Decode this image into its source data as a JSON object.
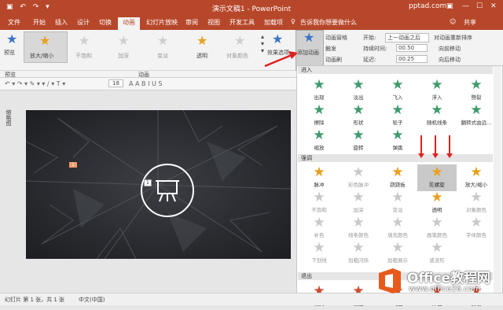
{
  "window": {
    "title": "演示文稿1 - PowerPoint",
    "site": "pptad.com",
    "share": "共享"
  },
  "tabs": [
    "文件",
    "开始",
    "插入",
    "设计",
    "切换",
    "动画",
    "幻灯片放映",
    "审阅",
    "视图",
    "开发工具",
    "加载项"
  ],
  "active_tab_index": 5,
  "tell_me": "告诉我你想要做什么",
  "ribbon": {
    "preview": "预览",
    "effects": [
      "放大/缩小",
      "不饱和",
      "加深",
      "变淡",
      "透明",
      "对象颜色"
    ],
    "effect_options": "效果选项",
    "add_animation": "添加动画",
    "animation_pane": "动画窗格",
    "trigger": "触发",
    "animation_painter": "动画刷",
    "start_label": "开始:",
    "start_value": "上一动画之后",
    "duration_label": "持续时间:",
    "duration_value": "00.50",
    "delay_label": "延迟:",
    "delay_value": "00.25",
    "reorder": "对动画重新排序",
    "move_earlier": "向前移动",
    "move_later": "向后移动",
    "group_preview": "预览",
    "group_animation": "动画",
    "font_size": "18"
  },
  "side_panel": "缩略图",
  "slide": {
    "tag1": "1",
    "tag2": "1"
  },
  "dropdown": {
    "sections": [
      {
        "title": "进入",
        "items": [
          {
            "label": "出现",
            "color": "#3f9a6e",
            "dim": false
          },
          {
            "label": "淡出",
            "color": "#3f9a6e",
            "dim": false
          },
          {
            "label": "飞入",
            "color": "#3f9a6e",
            "dim": false
          },
          {
            "label": "浮入",
            "color": "#3f9a6e",
            "dim": false
          },
          {
            "label": "劈裂",
            "color": "#3f9a6e",
            "dim": false
          },
          {
            "label": "擦除",
            "color": "#3f9a6e",
            "dim": false
          },
          {
            "label": "形状",
            "color": "#3f9a6e",
            "dim": false
          },
          {
            "label": "轮子",
            "color": "#3f9a6e",
            "dim": false
          },
          {
            "label": "随机线条",
            "color": "#3f9a6e",
            "dim": false
          },
          {
            "label": "翻转式由远...",
            "color": "#3f9a6e",
            "dim": false
          },
          {
            "label": "缩放",
            "color": "#3f9a6e",
            "dim": false
          },
          {
            "label": "旋转",
            "color": "#3f9a6e",
            "dim": false
          },
          {
            "label": "弹跳",
            "color": "#3f9a6e",
            "dim": false
          }
        ]
      },
      {
        "title": "强调",
        "items": [
          {
            "label": "脉冲",
            "color": "#e8a020",
            "dim": false
          },
          {
            "label": "彩色脉冲",
            "color": "#e8a020",
            "dim": true
          },
          {
            "label": "跷跷板",
            "color": "#e8a020",
            "dim": false
          },
          {
            "label": "陀螺旋",
            "color": "#e8a020",
            "dim": false,
            "selected": true
          },
          {
            "label": "放大/缩小",
            "color": "#e8a020",
            "dim": false
          },
          {
            "label": "不饱和",
            "color": "#e8a020",
            "dim": true
          },
          {
            "label": "加深",
            "color": "#e8a020",
            "dim": true
          },
          {
            "label": "变淡",
            "color": "#e8a020",
            "dim": true
          },
          {
            "label": "透明",
            "color": "#e8a020",
            "dim": false
          },
          {
            "label": "对象颜色",
            "color": "#e8a020",
            "dim": true
          },
          {
            "label": "补色",
            "color": "#e8a020",
            "dim": true
          },
          {
            "label": "线条颜色",
            "color": "#e8a020",
            "dim": true
          },
          {
            "label": "填充颜色",
            "color": "#e8a020",
            "dim": true
          },
          {
            "label": "画笔颜色",
            "color": "#e8a020",
            "dim": true
          },
          {
            "label": "字体颜色",
            "color": "#e8a020",
            "dim": true
          },
          {
            "label": "下划线",
            "color": "#e8a020",
            "dim": true
          },
          {
            "label": "加粗闪烁",
            "color": "#e8a020",
            "dim": true
          },
          {
            "label": "加粗展示",
            "color": "#e8a020",
            "dim": true
          },
          {
            "label": "波浪形",
            "color": "#e8a020",
            "dim": true
          }
        ]
      },
      {
        "title": "退出",
        "items": [
          {
            "label": "消失",
            "color": "#d04a30",
            "dim": false
          },
          {
            "label": "淡出",
            "color": "#d04a30",
            "dim": false
          },
          {
            "label": "飞出",
            "color": "#d04a30",
            "dim": false
          },
          {
            "label": "浮出",
            "color": "#d04a30",
            "dim": false
          },
          {
            "label": "劈裂",
            "color": "#d04a30",
            "dim": false
          }
        ]
      }
    ]
  },
  "status": {
    "slide_info": "幻灯片 第 1 张，共 1 张",
    "language": "中文(中国)"
  },
  "watermark": {
    "brand": "Office教程网",
    "url": "www.office26.com"
  }
}
